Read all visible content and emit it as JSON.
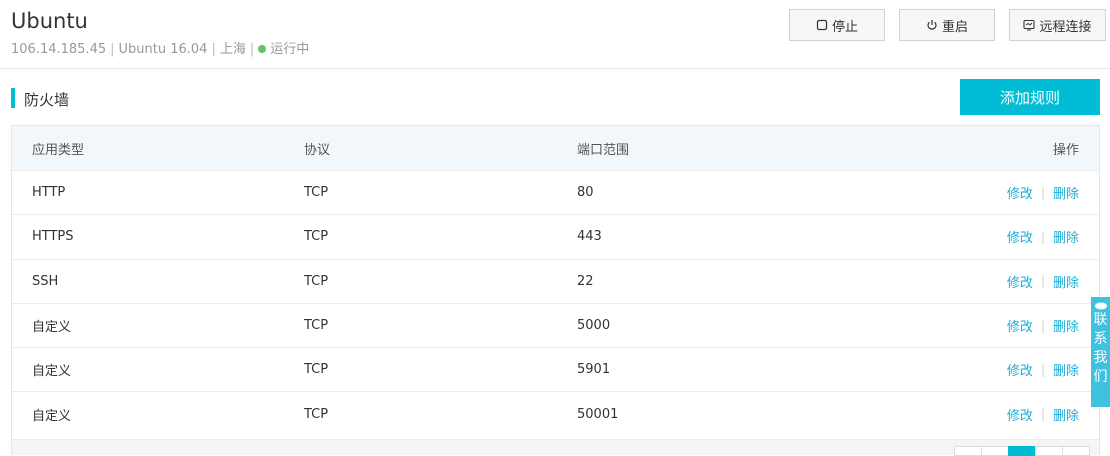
{
  "server": {
    "name": "Ubuntu",
    "ip": "106.14.185.45",
    "os": "Ubuntu 16.04",
    "region": "上海",
    "status": "运行中",
    "status_color": "#62c462"
  },
  "actions": {
    "stop": "停止",
    "restart": "重启",
    "remote": "远程连接"
  },
  "firewall": {
    "title": "防火墙",
    "add_label": "添加规则",
    "accent": "#00bcd4",
    "link_color": "#1aaed8",
    "headers": [
      "应用类型",
      "协议",
      "端口范围",
      "操作"
    ],
    "edit_label": "修改",
    "delete_label": "删除",
    "rows": [
      {
        "app": "HTTP",
        "protocol": "TCP",
        "port": "80"
      },
      {
        "app": "HTTPS",
        "protocol": "TCP",
        "port": "443"
      },
      {
        "app": "SSH",
        "protocol": "TCP",
        "port": "22"
      },
      {
        "app": "自定义",
        "protocol": "TCP",
        "port": "5000"
      },
      {
        "app": "自定义",
        "protocol": "TCP",
        "port": "5901"
      },
      {
        "app": "自定义",
        "protocol": "TCP",
        "port": "50001"
      }
    ]
  },
  "contact": {
    "label": [
      "联",
      "系",
      "我",
      "们"
    ],
    "color": "#3fc1e0"
  }
}
